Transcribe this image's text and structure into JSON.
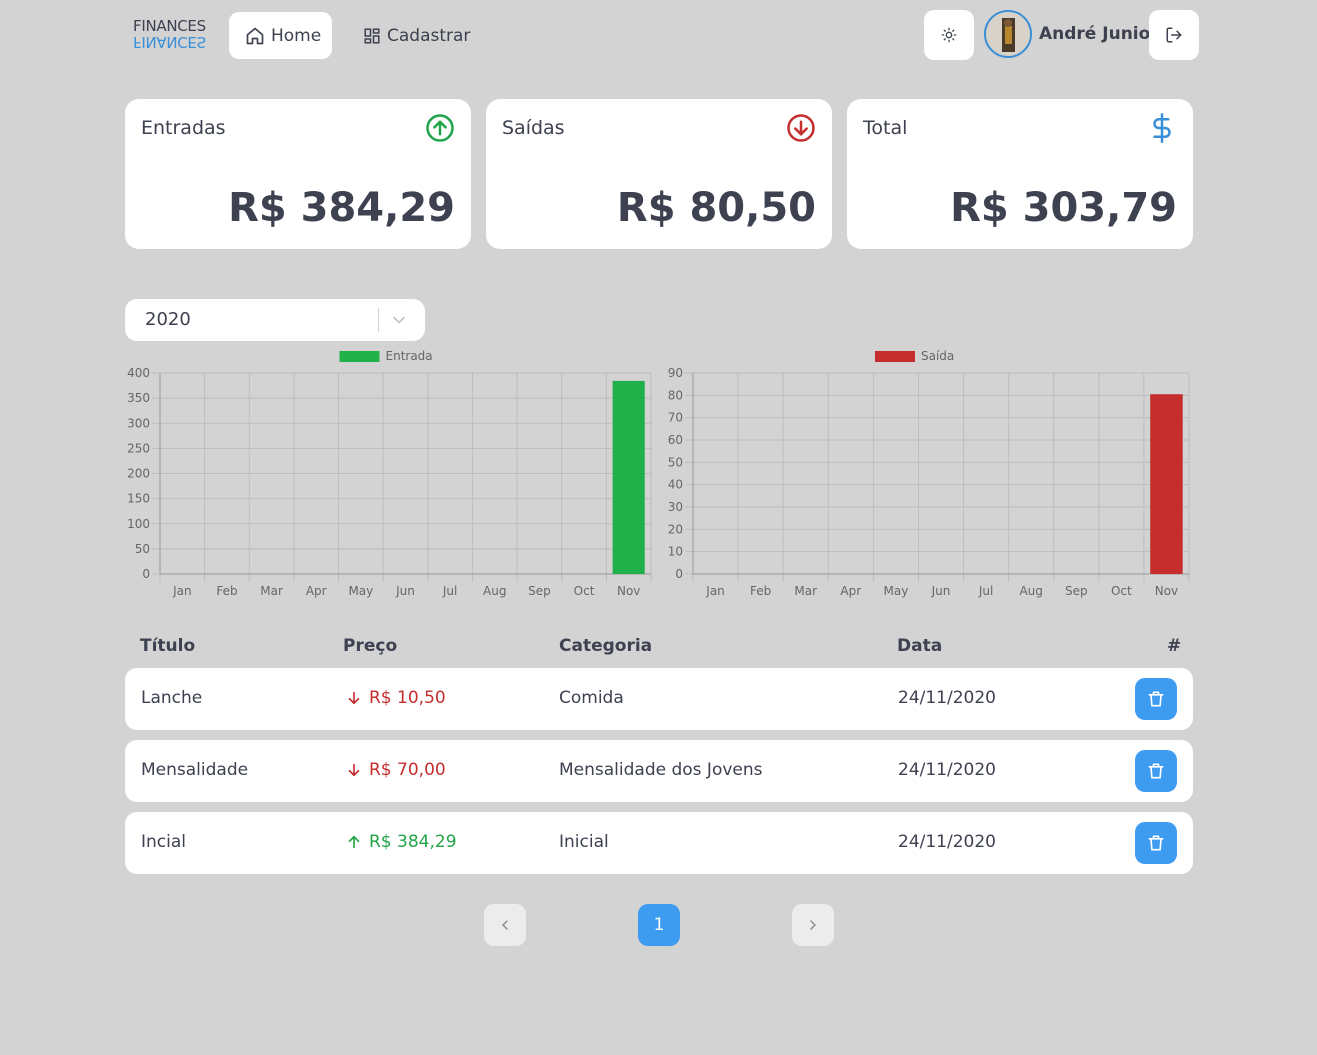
{
  "header": {
    "logo_top": "FINANCES",
    "logo_bottom": "FINANCES",
    "nav": [
      {
        "label": "Home",
        "icon": "home-icon",
        "active": true
      },
      {
        "label": "Cadastrar",
        "icon": "grid-icon",
        "active": false
      }
    ],
    "theme_icon": "sun-icon",
    "user_name": "André Junior",
    "logout_icon": "logout-icon"
  },
  "summary": {
    "income": {
      "label": "Entradas",
      "value": "R$ 384,29",
      "icon": "arrow-up-circle-icon",
      "color": "#22a447"
    },
    "expense": {
      "label": "Saídas",
      "value": "R$ 80,50",
      "icon": "arrow-down-circle-icon",
      "color": "#c62e2e"
    },
    "total": {
      "label": "Total",
      "value": "R$ 303,79",
      "icon": "dollar-icon",
      "color": "#3a8fd9"
    }
  },
  "year_select": {
    "value": "2020"
  },
  "chart_data": [
    {
      "type": "bar",
      "categories": [
        "Jan",
        "Feb",
        "Mar",
        "Apr",
        "May",
        "Jun",
        "Jul",
        "Aug",
        "Sep",
        "Oct",
        "Nov"
      ],
      "series": [
        {
          "name": "Entrada",
          "values": [
            0,
            0,
            0,
            0,
            0,
            0,
            0,
            0,
            0,
            0,
            384.29
          ],
          "color": "#22b04b"
        }
      ],
      "ylim": [
        0,
        400
      ],
      "yticks": [
        0,
        50,
        100,
        150,
        200,
        250,
        300,
        350,
        400
      ],
      "legend": "top",
      "grid": true
    },
    {
      "type": "bar",
      "categories": [
        "Jan",
        "Feb",
        "Mar",
        "Apr",
        "May",
        "Jun",
        "Jul",
        "Aug",
        "Sep",
        "Oct",
        "Nov"
      ],
      "series": [
        {
          "name": "Saída",
          "values": [
            0,
            0,
            0,
            0,
            0,
            0,
            0,
            0,
            0,
            0,
            80.5
          ],
          "color": "#c62e2e"
        }
      ],
      "ylim": [
        0,
        90
      ],
      "yticks": [
        0,
        10,
        20,
        30,
        40,
        50,
        60,
        70,
        80,
        90
      ],
      "legend": "top",
      "grid": true
    }
  ],
  "table": {
    "headers": {
      "title": "Título",
      "price": "Preço",
      "category": "Categoria",
      "date": "Data",
      "actions": "#"
    },
    "rows": [
      {
        "title": "Lanche",
        "price": "R$ 10,50",
        "type": "out",
        "category": "Comida",
        "date": "24/11/2020"
      },
      {
        "title": "Mensalidade",
        "price": "R$ 70,00",
        "type": "out",
        "category": "Mensalidade dos Jovens",
        "date": "24/11/2020"
      },
      {
        "title": "Incial",
        "price": "R$ 384,29",
        "type": "in",
        "category": "Inicial",
        "date": "24/11/2020"
      }
    ]
  },
  "pagination": {
    "current": "1",
    "prev_icon": "chevron-left-icon",
    "next_icon": "chevron-right-icon"
  },
  "colors": {
    "in": "#22a447",
    "out": "#c62e2e",
    "accent": "#3d9cf0"
  }
}
